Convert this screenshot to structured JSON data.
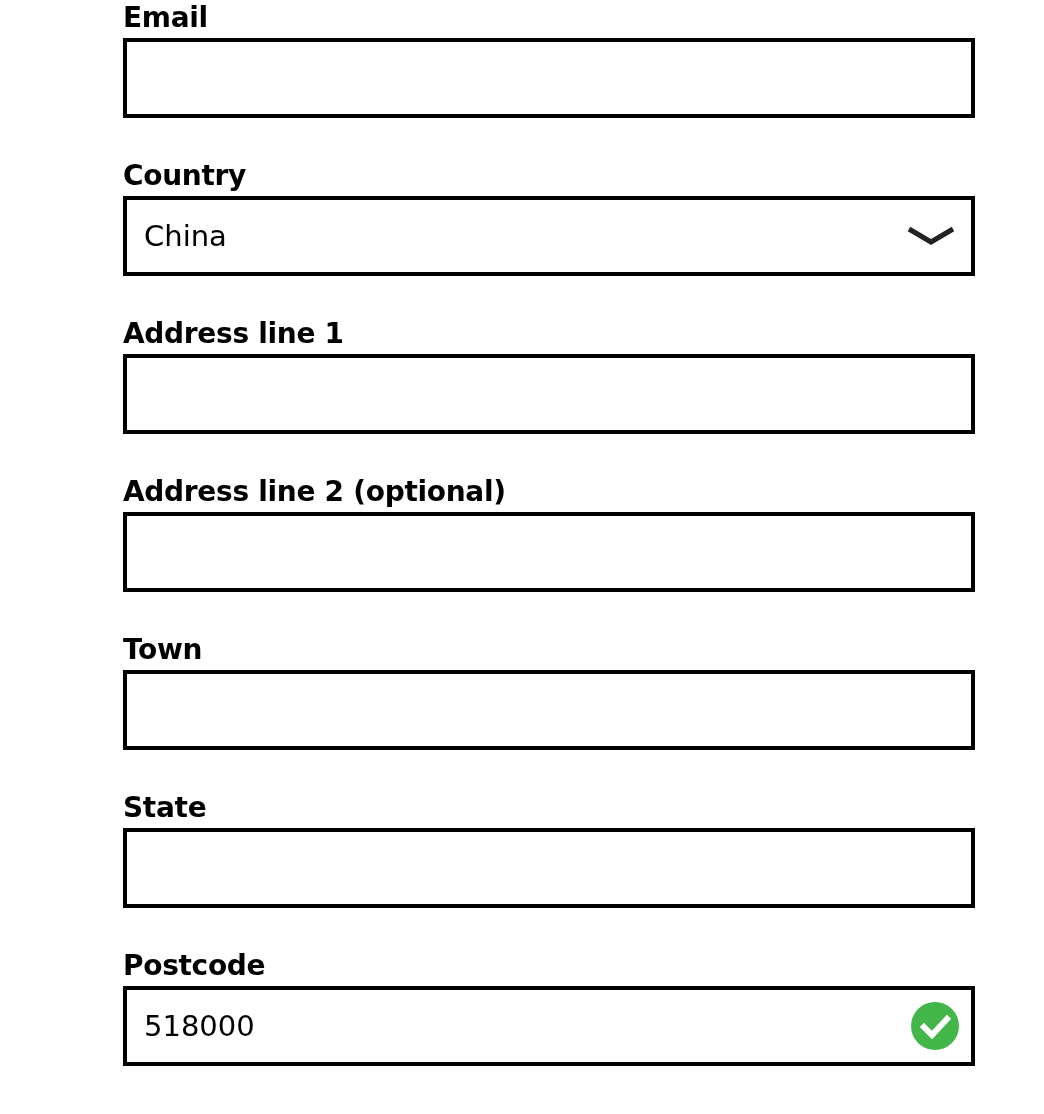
{
  "form": {
    "fields": [
      {
        "kind": "text",
        "label": "Email",
        "valid": false
      },
      {
        "kind": "select",
        "label": "Country",
        "value": "China"
      },
      {
        "kind": "text",
        "label": "Address line 1",
        "valid": false
      },
      {
        "kind": "text",
        "label": "Address line 2 (optional)",
        "valid": false
      },
      {
        "kind": "text",
        "label": "Town",
        "valid": false
      },
      {
        "kind": "text",
        "label": "State",
        "valid": false
      },
      {
        "kind": "text",
        "label": "Postcode",
        "value": "518000",
        "valid": true
      }
    ]
  }
}
